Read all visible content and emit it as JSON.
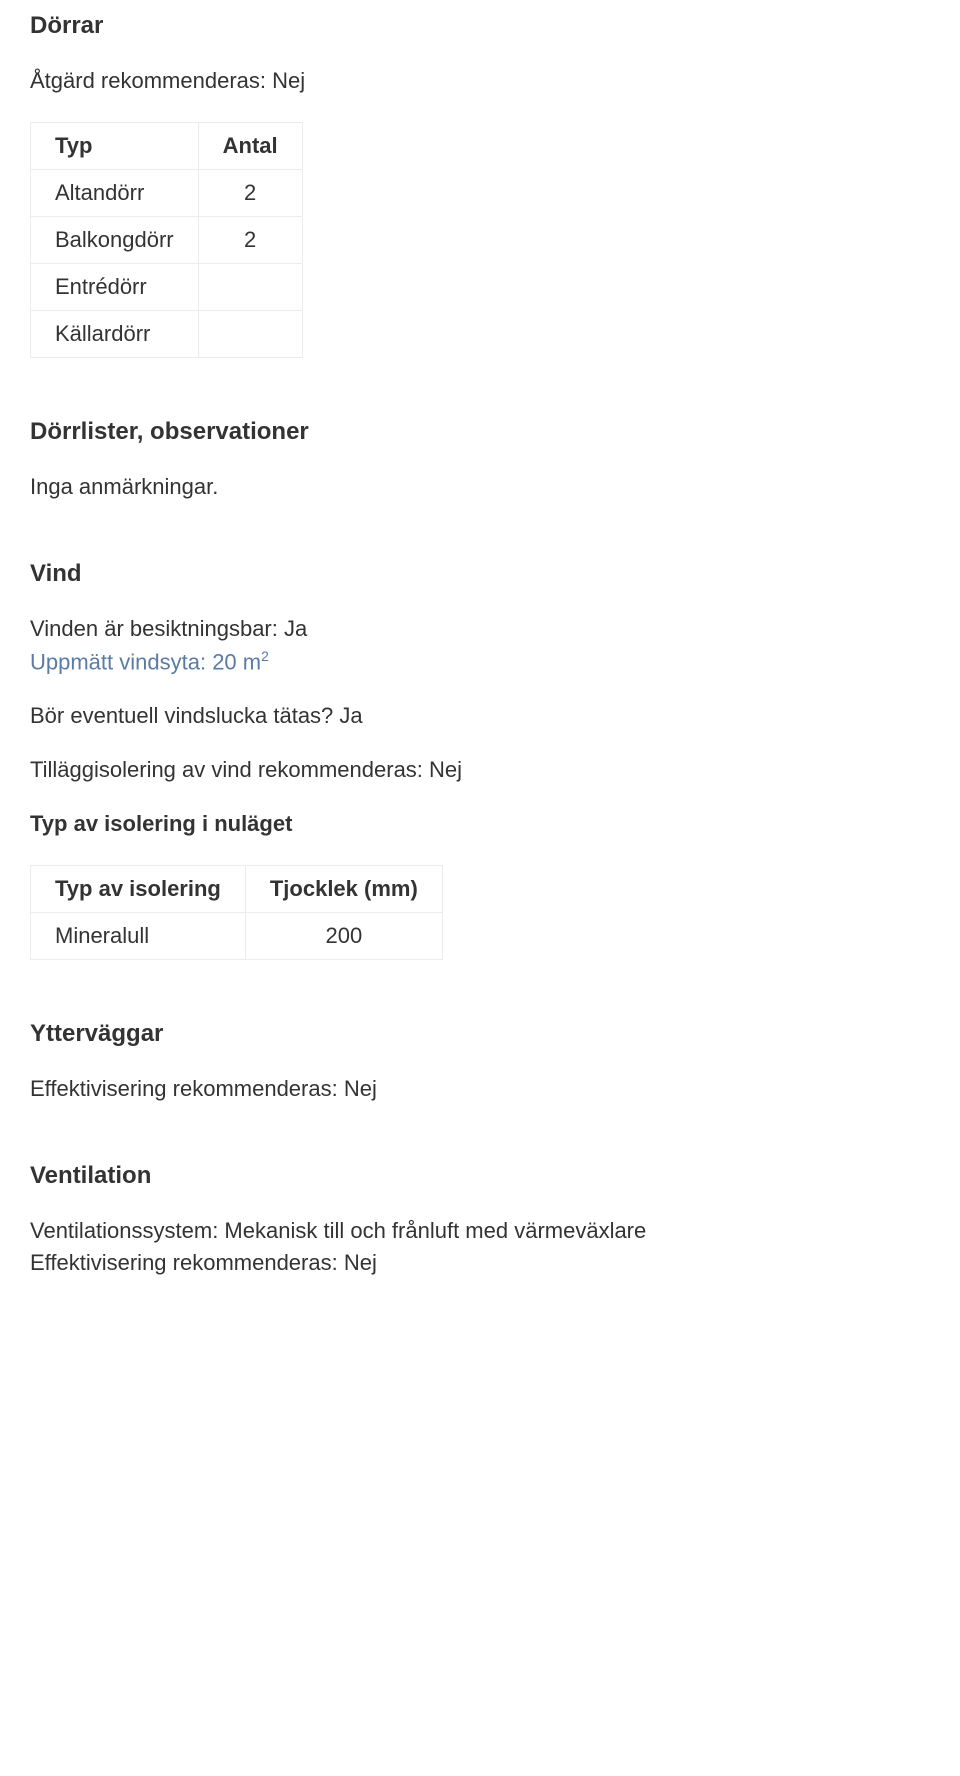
{
  "dorrar": {
    "heading": "Dörrar",
    "action_line": "Åtgärd rekommenderas: Nej",
    "table": {
      "headers": [
        "Typ",
        "Antal"
      ],
      "rows": [
        {
          "typ": "Altandörr",
          "antal": "2"
        },
        {
          "typ": "Balkongdörr",
          "antal": "2"
        },
        {
          "typ": "Entrédörr",
          "antal": ""
        },
        {
          "typ": "Källardörr",
          "antal": ""
        }
      ]
    }
  },
  "dorrlister": {
    "heading": "Dörrlister, observationer",
    "text": "Inga anmärkningar."
  },
  "vind": {
    "heading": "Vind",
    "besiktningsbar": "Vinden är besiktningsbar: Ja",
    "vindsyta_prefix": "Uppmätt vindsyta: 20 m",
    "vindsyta_sup": "2",
    "vindslucka": "Bör eventuell vindslucka tätas? Ja",
    "tillaggsisolering": "Tilläggisolering av vind rekommenderas: Nej",
    "iso_heading": "Typ av isolering i nuläget",
    "iso_table": {
      "headers": [
        "Typ av isolering",
        "Tjocklek (mm)"
      ],
      "rows": [
        {
          "typ": "Mineralull",
          "tjocklek": "200"
        }
      ]
    }
  },
  "yttervaggar": {
    "heading": "Ytterväggar",
    "text": "Effektivisering rekommenderas: Nej"
  },
  "ventilation": {
    "heading": "Ventilation",
    "system": "Ventilationssystem: Mekanisk till och frånluft med värmeväxlare",
    "effekt": "Effektivisering rekommenderas: Nej"
  }
}
